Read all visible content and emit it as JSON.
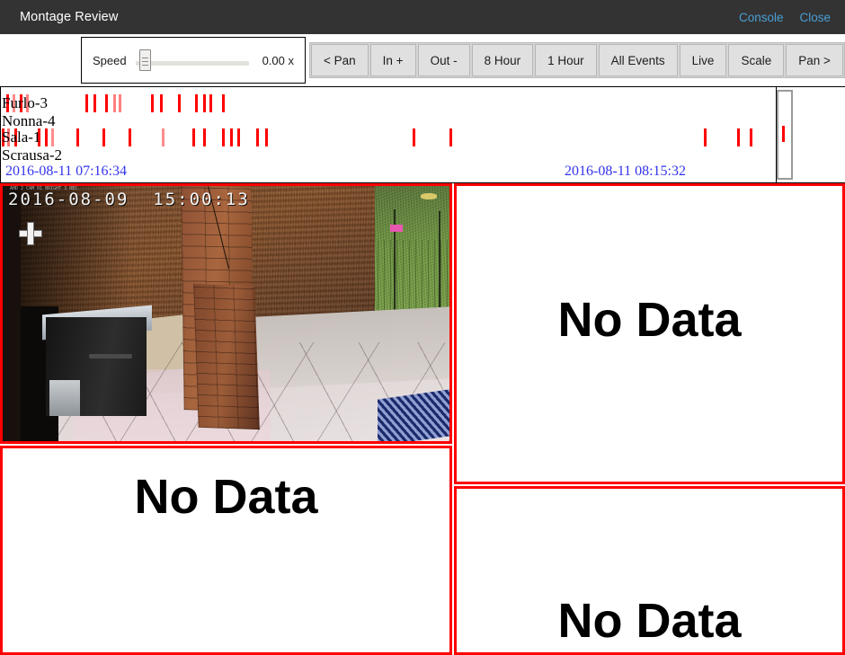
{
  "header": {
    "title": "Montage Review",
    "console_label": "Console",
    "close_label": "Close"
  },
  "toolbar": {
    "speed_label": "Speed",
    "speed_value": "0.00 x",
    "speed_slider_position_pct": 5,
    "buttons": [
      {
        "label": "< Pan",
        "name": "pan-left-button"
      },
      {
        "label": "In +",
        "name": "zoom-in-button"
      },
      {
        "label": "Out -",
        "name": "zoom-out-button"
      },
      {
        "label": "8 Hour",
        "name": "range-8-hour-button"
      },
      {
        "label": "1 Hour",
        "name": "range-1-hour-button"
      },
      {
        "label": "All Events",
        "name": "all-events-button"
      },
      {
        "label": "Live",
        "name": "live-button"
      },
      {
        "label": "Scale",
        "name": "scale-button"
      },
      {
        "label": "Pan >",
        "name": "pan-right-button"
      }
    ]
  },
  "timeline": {
    "start_time": "2016-08-11 07:16:34",
    "end_time": "2016-08-11 08:15:32",
    "event_color": "#ff0000",
    "time_color": "#3333ee",
    "cameras": [
      {
        "label": "Furlo-3"
      },
      {
        "label": "Nonna-4"
      },
      {
        "label": "Sala-1"
      },
      {
        "label": "Scrausa-2"
      }
    ],
    "events": {
      "Furlo-3": [
        {
          "x_pct": 0.8,
          "opacity": 1.0
        },
        {
          "x_pct": 1.6,
          "opacity": 0.45
        },
        {
          "x_pct": 2.6,
          "opacity": 1.0
        },
        {
          "x_pct": 3.4,
          "opacity": 0.5
        },
        {
          "x_pct": 11.0,
          "opacity": 1.0
        },
        {
          "x_pct": 12.1,
          "opacity": 1.0
        },
        {
          "x_pct": 13.6,
          "opacity": 1.0
        },
        {
          "x_pct": 14.6,
          "opacity": 0.5
        },
        {
          "x_pct": 15.3,
          "opacity": 0.5
        },
        {
          "x_pct": 19.5,
          "opacity": 1.0
        },
        {
          "x_pct": 20.6,
          "opacity": 1.0
        },
        {
          "x_pct": 22.9,
          "opacity": 1.0
        },
        {
          "x_pct": 25.2,
          "opacity": 1.0
        },
        {
          "x_pct": 26.2,
          "opacity": 1.0
        },
        {
          "x_pct": 27.0,
          "opacity": 1.0
        },
        {
          "x_pct": 28.6,
          "opacity": 1.0
        }
      ],
      "Nonna-4": [],
      "Sala-1": [
        {
          "x_pct": 0.2,
          "opacity": 1.0
        },
        {
          "x_pct": 0.9,
          "opacity": 0.55
        },
        {
          "x_pct": 1.8,
          "opacity": 1.0
        },
        {
          "x_pct": 4.9,
          "opacity": 1.0
        },
        {
          "x_pct": 5.8,
          "opacity": 1.0
        },
        {
          "x_pct": 6.6,
          "opacity": 0.45
        },
        {
          "x_pct": 9.9,
          "opacity": 1.0
        },
        {
          "x_pct": 13.2,
          "opacity": 1.0
        },
        {
          "x_pct": 16.6,
          "opacity": 1.0
        },
        {
          "x_pct": 20.9,
          "opacity": 0.45
        },
        {
          "x_pct": 24.8,
          "opacity": 1.0
        },
        {
          "x_pct": 26.2,
          "opacity": 1.0
        },
        {
          "x_pct": 28.6,
          "opacity": 1.0
        },
        {
          "x_pct": 29.7,
          "opacity": 1.0
        },
        {
          "x_pct": 30.6,
          "opacity": 1.0
        },
        {
          "x_pct": 33.0,
          "opacity": 1.0
        },
        {
          "x_pct": 34.2,
          "opacity": 1.0
        },
        {
          "x_pct": 53.2,
          "opacity": 1.0
        },
        {
          "x_pct": 57.9,
          "opacity": 1.0
        },
        {
          "x_pct": 90.7,
          "opacity": 1.0
        },
        {
          "x_pct": 95.0,
          "opacity": 1.0
        },
        {
          "x_pct": 96.6,
          "opacity": 1.0
        }
      ],
      "Scrausa-2": []
    },
    "scrollbar": {
      "name": "timeline-scrollbar",
      "has_event_mark": true
    }
  },
  "montage": {
    "border_color": "#ff0000",
    "no_data_label": "No Data",
    "panes": [
      {
        "name": "montage-pane-1",
        "state": "video",
        "osd_time": "2016-08-09  15:00:13",
        "osd_sub": "AHD 2 CAM 01 BRIGHT 3 REC",
        "camera": "Furlo-3"
      },
      {
        "name": "montage-pane-2",
        "state": "no-data"
      },
      {
        "name": "montage-pane-3",
        "state": "no-data"
      },
      {
        "name": "montage-pane-4",
        "state": "no-data"
      }
    ]
  }
}
